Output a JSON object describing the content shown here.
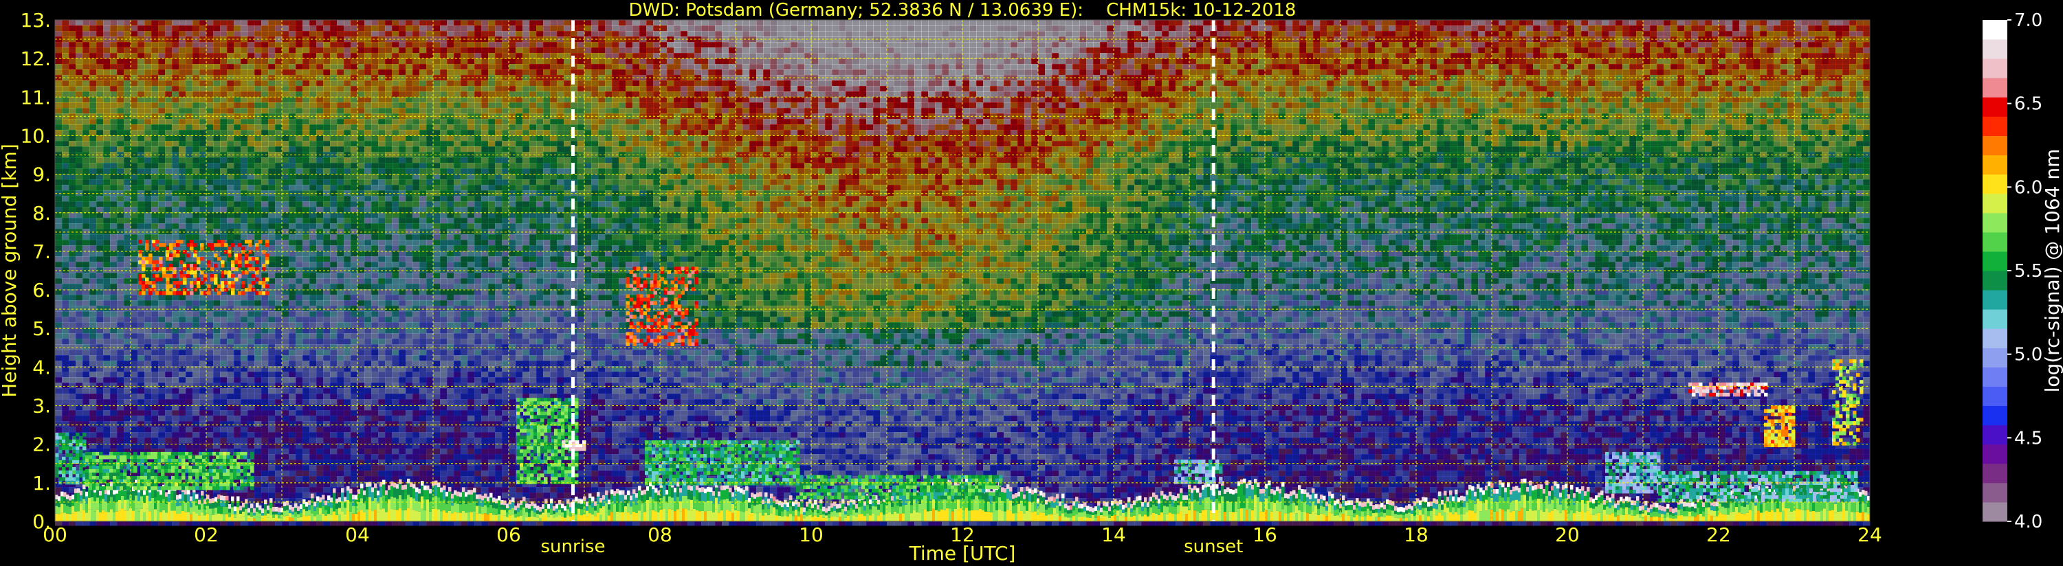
{
  "chart_data": {
    "type": "heatmap",
    "title": "DWD: Potsdam (Germany; 52.3836 N / 13.0639 E):    CHM15k: 10-12-2018",
    "xlabel": "Time [UTC]",
    "ylabel": "Height above ground [km]",
    "colorbar_label": "log(rc-signal) @ 1064 nm",
    "xlim": [
      0,
      24
    ],
    "ylim": [
      0,
      13
    ],
    "x_ticks": [
      {
        "value": 0,
        "label": "00"
      },
      {
        "value": 2,
        "label": "02"
      },
      {
        "value": 4,
        "label": "04"
      },
      {
        "value": 6,
        "label": "06"
      },
      {
        "value": 8,
        "label": "08"
      },
      {
        "value": 10,
        "label": "10"
      },
      {
        "value": 12,
        "label": "12"
      },
      {
        "value": 14,
        "label": "14"
      },
      {
        "value": 16,
        "label": "16"
      },
      {
        "value": 18,
        "label": "18"
      },
      {
        "value": 20,
        "label": "20"
      },
      {
        "value": 22,
        "label": "22"
      },
      {
        "value": 24,
        "label": "24"
      }
    ],
    "y_ticks": [
      {
        "value": 0,
        "label": "0."
      },
      {
        "value": 1,
        "label": "1."
      },
      {
        "value": 2,
        "label": "2."
      },
      {
        "value": 3,
        "label": "3."
      },
      {
        "value": 4,
        "label": "4."
      },
      {
        "value": 5,
        "label": "5."
      },
      {
        "value": 6,
        "label": "6."
      },
      {
        "value": 7,
        "label": "7."
      },
      {
        "value": 8,
        "label": "8."
      },
      {
        "value": 9,
        "label": "9."
      },
      {
        "value": 10,
        "label": "10."
      },
      {
        "value": 11,
        "label": "11."
      },
      {
        "value": 12,
        "label": "12."
      },
      {
        "value": 13,
        "label": "13."
      }
    ],
    "colorbar_range": [
      4.0,
      7.0
    ],
    "colorbar_ticks": [
      {
        "value": 4.0,
        "label": "4.0"
      },
      {
        "value": 4.5,
        "label": "4.5"
      },
      {
        "value": 5.0,
        "label": "5.0"
      },
      {
        "value": 5.5,
        "label": "5.5"
      },
      {
        "value": 6.0,
        "label": "6.0"
      },
      {
        "value": 6.5,
        "label": "6.5"
      },
      {
        "value": 7.0,
        "label": "7.0"
      }
    ],
    "colorscale": [
      "#9e8aa0",
      "#8a5c8e",
      "#7a2d85",
      "#6a0ea0",
      "#4a10c8",
      "#1a30f0",
      "#4b5cf5",
      "#6f7ef2",
      "#8e9ff0",
      "#a7bdf0",
      "#6fd0d8",
      "#22a7a0",
      "#0d8f47",
      "#11b03a",
      "#52d24a",
      "#8ee85b",
      "#d6f04a",
      "#ffe21a",
      "#ffb000",
      "#ff7a00",
      "#ff2a00",
      "#e80000",
      "#f08a92",
      "#f0c0c8",
      "#ecdde2",
      "#ffffff"
    ],
    "grid": true,
    "annotations": [
      {
        "x": 6.85,
        "label": "sunrise"
      },
      {
        "x": 15.32,
        "label": "sunset"
      }
    ],
    "colors": {
      "background": "#000000",
      "text": "#ffff33",
      "colorbar_text": "#ffffff",
      "grid": "#ffff00",
      "annotation_line": "#ffffff"
    }
  }
}
